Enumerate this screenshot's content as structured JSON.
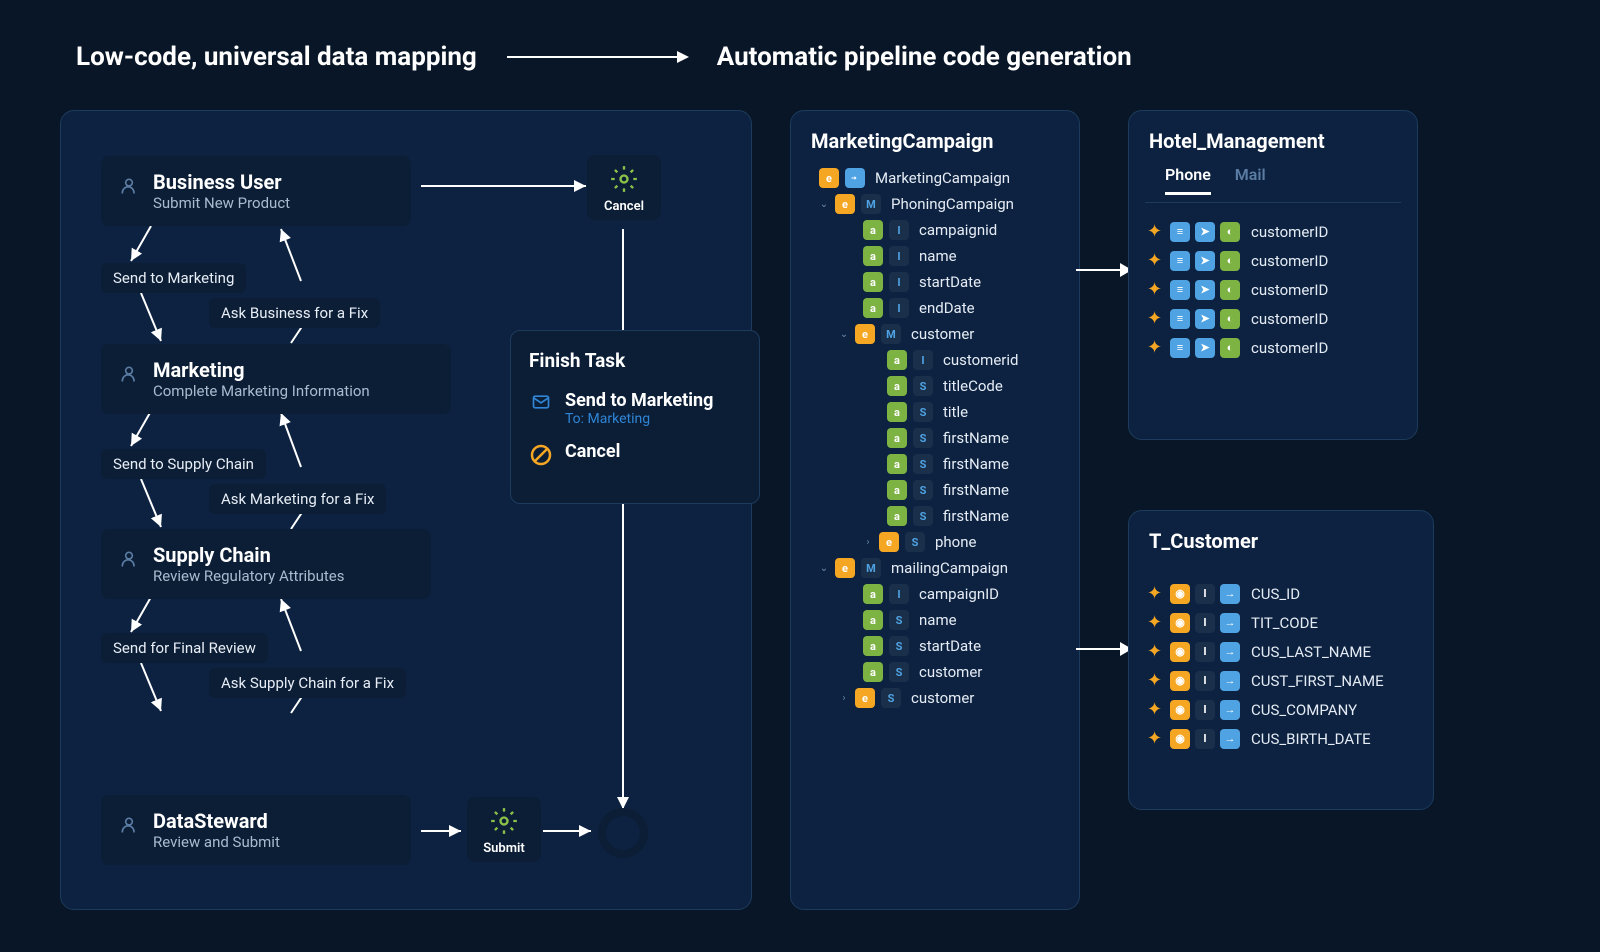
{
  "headers": {
    "left": "Low-code, universal data mapping",
    "right": "Automatic pipeline code generation"
  },
  "workflow": {
    "cards": [
      {
        "title": "Business User",
        "sub": "Submit New Product"
      },
      {
        "title": "Marketing",
        "sub": "Complete Marketing Information"
      },
      {
        "title": "Supply Chain",
        "sub": "Review Regulatory Attributes"
      },
      {
        "title": "DataSteward",
        "sub": "Review and Submit"
      }
    ],
    "pills": {
      "send_marketing": "Send to Marketing",
      "ask_business": "Ask Business for a Fix",
      "send_supply": "Send to Supply Chain",
      "ask_marketing": "Ask Marketing for a Fix",
      "send_final": "Send for Final Review",
      "ask_supply": "Ask Supply Chain for a Fix"
    },
    "cancel": "Cancel",
    "submit": "Submit"
  },
  "finish": {
    "title": "Finish Task",
    "send_label": "Send to Marketing",
    "to": "To: Marketing",
    "cancel": "Cancel"
  },
  "marketing_tree": {
    "title": "MarketingCampaign",
    "root": "MarketingCampaign",
    "phoning": "PhoningCampaign",
    "campaignid_l": "campaignid",
    "name": "name",
    "startDate": "startDate",
    "endDate": "endDate",
    "customer": "customer",
    "customerid": "customerid",
    "titleCode": "titleCode",
    "ttl": "title",
    "firstName": "firstName",
    "phone": "phone",
    "mailing": "mailingCampaign",
    "campaignID2": "campaignID",
    "name2": "name",
    "startDate2": "startDate",
    "customer2": "customer",
    "customer3": "customer"
  },
  "hotel": {
    "title": "Hotel_Management",
    "tab_phone": "Phone",
    "tab_mail": "Mail",
    "field": "customerID"
  },
  "customer": {
    "title": "T_Customer",
    "fields": [
      "CUS_ID",
      "TIT_CODE",
      "CUS_LAST_NAME",
      "CUST_FIRST_NAME",
      "CUS_COMPANY",
      "CUS_BIRTH_DATE"
    ]
  }
}
